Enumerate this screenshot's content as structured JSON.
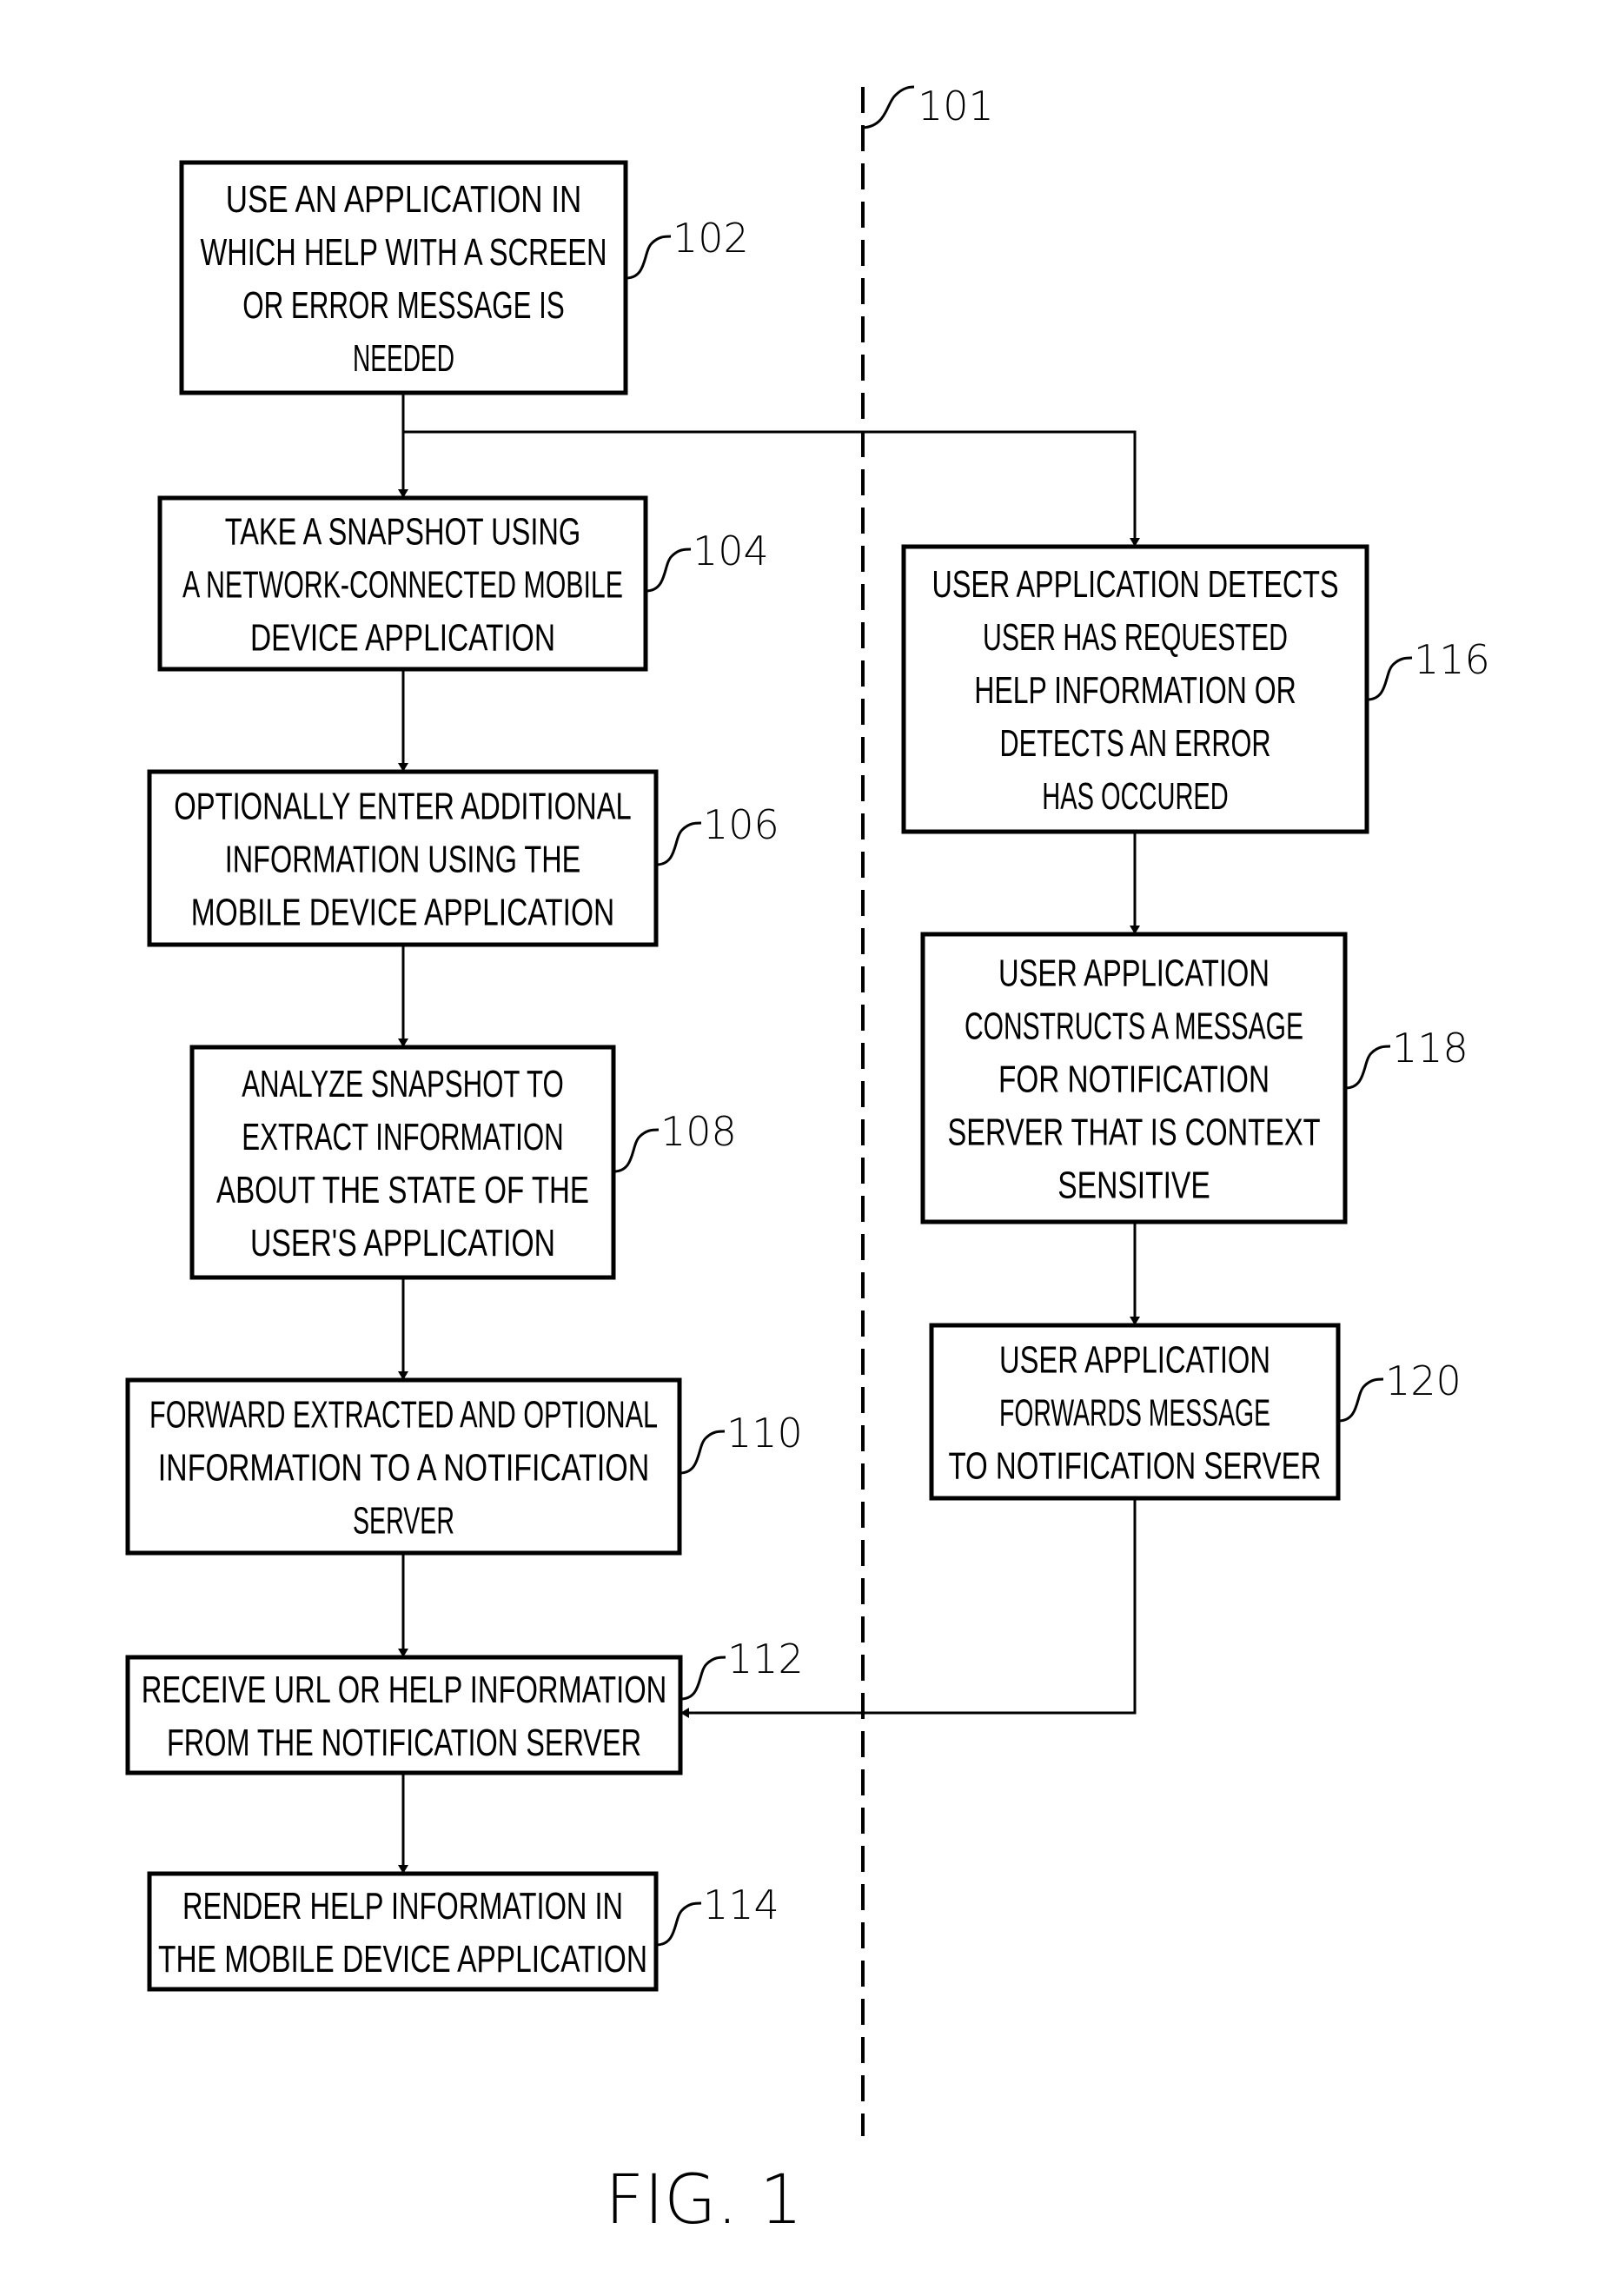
{
  "figure_label": "FIG. 1",
  "divider_ref": "101",
  "steps": [
    {
      "ref": "102",
      "lines": [
        "USE AN APPLICATION IN",
        "WHICH HELP WITH A SCREEN",
        "OR ERROR MESSAGE IS",
        "NEEDED"
      ]
    },
    {
      "ref": "104",
      "lines": [
        "TAKE A SNAPSHOT USING",
        "A NETWORK-CONNECTED MOBILE",
        "DEVICE APPLICATION"
      ]
    },
    {
      "ref": "106",
      "lines": [
        "OPTIONALLY ENTER ADDITIONAL",
        "INFORMATION USING THE",
        "MOBILE DEVICE APPLICATION"
      ]
    },
    {
      "ref": "108",
      "lines": [
        "ANALYZE SNAPSHOT TO",
        "EXTRACT INFORMATION",
        "ABOUT THE STATE OF THE",
        "USER'S APPLICATION"
      ]
    },
    {
      "ref": "110",
      "lines": [
        "FORWARD EXTRACTED AND OPTIONAL",
        "INFORMATION TO A NOTIFICATION",
        "SERVER"
      ]
    },
    {
      "ref": "112",
      "lines": [
        "RECEIVE URL OR HELP INFORMATION",
        "FROM THE NOTIFICATION SERVER"
      ]
    },
    {
      "ref": "114",
      "lines": [
        "RENDER HELP INFORMATION IN",
        "THE MOBILE DEVICE APPLICATION"
      ]
    },
    {
      "ref": "116",
      "lines": [
        "USER APPLICATION DETECTS",
        "USER HAS REQUESTED",
        "HELP INFORMATION OR",
        "DETECTS AN ERROR",
        "HAS OCCURED"
      ]
    },
    {
      "ref": "118",
      "lines": [
        "USER APPLICATION",
        "CONSTRUCTS A MESSAGE",
        "FOR NOTIFICATION",
        "SERVER THAT IS CONTEXT",
        "SENSITIVE"
      ]
    },
    {
      "ref": "120",
      "lines": [
        "USER APPLICATION",
        "FORWARDS MESSAGE",
        "TO NOTIFICATION SERVER"
      ]
    }
  ]
}
